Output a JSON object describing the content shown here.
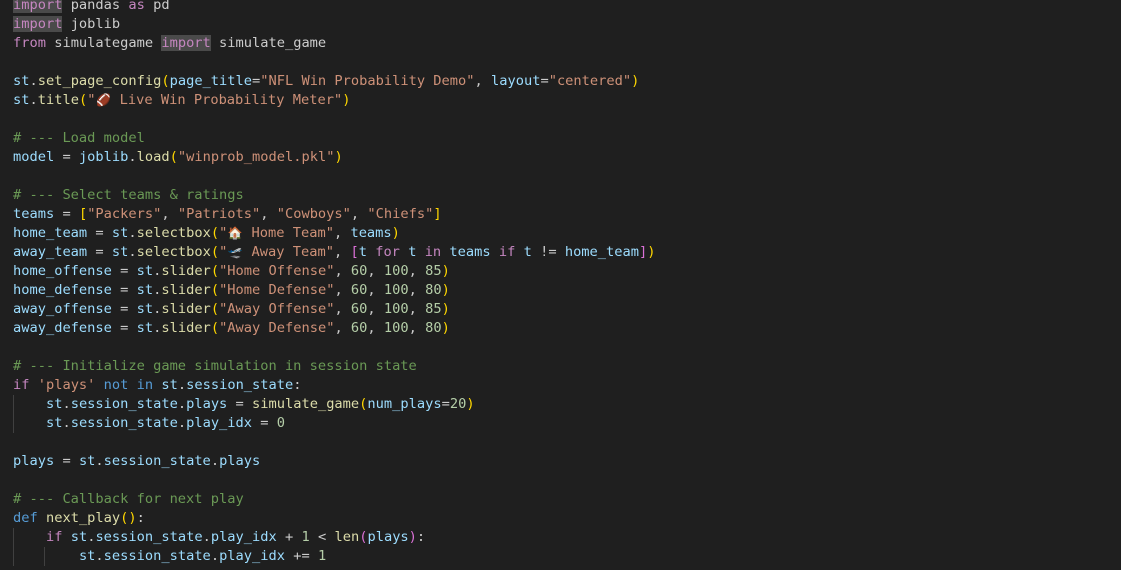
{
  "editor": {
    "language": "python",
    "theme_colors": {
      "background": "#1f1f1f",
      "plain": "#cccccc",
      "keyword": "#c586c0",
      "keyword_blue": "#569cd6",
      "string": "#ce9178",
      "number": "#b5cea8",
      "variable": "#9cdcfe",
      "function": "#dcdcaa",
      "comment": "#6a9955",
      "bracket_1": "#ffd700",
      "bracket_2": "#da70d6",
      "bracket_3": "#179fff"
    },
    "lines": [
      {
        "indent": 0,
        "tokens": [
          {
            "t": "import",
            "c": "keyword",
            "hl": true
          },
          {
            "t": " pandas ",
            "c": "plain"
          },
          {
            "t": "as",
            "c": "keyword"
          },
          {
            "t": " pd",
            "c": "plain"
          }
        ]
      },
      {
        "indent": 0,
        "tokens": [
          {
            "t": "import",
            "c": "keyword",
            "hl": true
          },
          {
            "t": " joblib",
            "c": "plain"
          }
        ]
      },
      {
        "indent": 0,
        "tokens": [
          {
            "t": "from",
            "c": "keyword"
          },
          {
            "t": " simulategame ",
            "c": "plain"
          },
          {
            "t": "import",
            "c": "keyword",
            "hl": true
          },
          {
            "t": " simulate_game",
            "c": "plain"
          }
        ]
      },
      {
        "indent": 0,
        "tokens": []
      },
      {
        "indent": 0,
        "tokens": [
          {
            "t": "st",
            "c": "variable"
          },
          {
            "t": ".",
            "c": "plain"
          },
          {
            "t": "set_page_config",
            "c": "function"
          },
          {
            "t": "(",
            "c": "bracket_1"
          },
          {
            "t": "page_title",
            "c": "variable"
          },
          {
            "t": "=",
            "c": "plain"
          },
          {
            "t": "\"NFL Win Probability Demo\"",
            "c": "string"
          },
          {
            "t": ", ",
            "c": "plain"
          },
          {
            "t": "layout",
            "c": "variable"
          },
          {
            "t": "=",
            "c": "plain"
          },
          {
            "t": "\"centered\"",
            "c": "string"
          },
          {
            "t": ")",
            "c": "bracket_1"
          }
        ]
      },
      {
        "indent": 0,
        "tokens": [
          {
            "t": "st",
            "c": "variable"
          },
          {
            "t": ".",
            "c": "plain"
          },
          {
            "t": "title",
            "c": "function"
          },
          {
            "t": "(",
            "c": "bracket_1"
          },
          {
            "t": "\"",
            "c": "string"
          },
          {
            "t": "🏈",
            "c": "emoji"
          },
          {
            "t": " Live Win Probability Meter\"",
            "c": "string"
          },
          {
            "t": ")",
            "c": "bracket_1"
          }
        ]
      },
      {
        "indent": 0,
        "tokens": []
      },
      {
        "indent": 0,
        "tokens": [
          {
            "t": "# --- Load model",
            "c": "comment"
          }
        ]
      },
      {
        "indent": 0,
        "tokens": [
          {
            "t": "model",
            "c": "variable"
          },
          {
            "t": " = ",
            "c": "plain"
          },
          {
            "t": "joblib",
            "c": "variable"
          },
          {
            "t": ".",
            "c": "plain"
          },
          {
            "t": "load",
            "c": "function"
          },
          {
            "t": "(",
            "c": "bracket_1"
          },
          {
            "t": "\"winprob_model.pkl\"",
            "c": "string"
          },
          {
            "t": ")",
            "c": "bracket_1"
          }
        ]
      },
      {
        "indent": 0,
        "tokens": []
      },
      {
        "indent": 0,
        "tokens": [
          {
            "t": "# --- Select teams & ratings",
            "c": "comment"
          }
        ]
      },
      {
        "indent": 0,
        "tokens": [
          {
            "t": "teams",
            "c": "variable"
          },
          {
            "t": " = ",
            "c": "plain"
          },
          {
            "t": "[",
            "c": "bracket_1"
          },
          {
            "t": "\"Packers\"",
            "c": "string"
          },
          {
            "t": ", ",
            "c": "plain"
          },
          {
            "t": "\"Patriots\"",
            "c": "string"
          },
          {
            "t": ", ",
            "c": "plain"
          },
          {
            "t": "\"Cowboys\"",
            "c": "string"
          },
          {
            "t": ", ",
            "c": "plain"
          },
          {
            "t": "\"Chiefs\"",
            "c": "string"
          },
          {
            "t": "]",
            "c": "bracket_1"
          }
        ]
      },
      {
        "indent": 0,
        "tokens": [
          {
            "t": "home_team",
            "c": "variable"
          },
          {
            "t": " = ",
            "c": "plain"
          },
          {
            "t": "st",
            "c": "variable"
          },
          {
            "t": ".",
            "c": "plain"
          },
          {
            "t": "selectbox",
            "c": "function"
          },
          {
            "t": "(",
            "c": "bracket_1"
          },
          {
            "t": "\"",
            "c": "string"
          },
          {
            "t": "🏠",
            "c": "emoji"
          },
          {
            "t": " Home Team\"",
            "c": "string"
          },
          {
            "t": ", ",
            "c": "plain"
          },
          {
            "t": "teams",
            "c": "variable"
          },
          {
            "t": ")",
            "c": "bracket_1"
          }
        ]
      },
      {
        "indent": 0,
        "tokens": [
          {
            "t": "away_team",
            "c": "variable"
          },
          {
            "t": " = ",
            "c": "plain"
          },
          {
            "t": "st",
            "c": "variable"
          },
          {
            "t": ".",
            "c": "plain"
          },
          {
            "t": "selectbox",
            "c": "function"
          },
          {
            "t": "(",
            "c": "bracket_1"
          },
          {
            "t": "\"",
            "c": "string"
          },
          {
            "t": "🛫",
            "c": "emoji"
          },
          {
            "t": " Away Team\"",
            "c": "string"
          },
          {
            "t": ", ",
            "c": "plain"
          },
          {
            "t": "[",
            "c": "bracket_2"
          },
          {
            "t": "t",
            "c": "variable"
          },
          {
            "t": " ",
            "c": "plain"
          },
          {
            "t": "for",
            "c": "keyword"
          },
          {
            "t": " ",
            "c": "plain"
          },
          {
            "t": "t",
            "c": "variable"
          },
          {
            "t": " ",
            "c": "plain"
          },
          {
            "t": "in",
            "c": "keyword"
          },
          {
            "t": " ",
            "c": "plain"
          },
          {
            "t": "teams",
            "c": "variable"
          },
          {
            "t": " ",
            "c": "plain"
          },
          {
            "t": "if",
            "c": "keyword"
          },
          {
            "t": " ",
            "c": "plain"
          },
          {
            "t": "t",
            "c": "variable"
          },
          {
            "t": " != ",
            "c": "plain"
          },
          {
            "t": "home_team",
            "c": "variable"
          },
          {
            "t": "]",
            "c": "bracket_2"
          },
          {
            "t": ")",
            "c": "bracket_1"
          }
        ]
      },
      {
        "indent": 0,
        "tokens": [
          {
            "t": "home_offense",
            "c": "variable"
          },
          {
            "t": " = ",
            "c": "plain"
          },
          {
            "t": "st",
            "c": "variable"
          },
          {
            "t": ".",
            "c": "plain"
          },
          {
            "t": "slider",
            "c": "function"
          },
          {
            "t": "(",
            "c": "bracket_1"
          },
          {
            "t": "\"Home Offense\"",
            "c": "string"
          },
          {
            "t": ", ",
            "c": "plain"
          },
          {
            "t": "60",
            "c": "number"
          },
          {
            "t": ", ",
            "c": "plain"
          },
          {
            "t": "100",
            "c": "number"
          },
          {
            "t": ", ",
            "c": "plain"
          },
          {
            "t": "85",
            "c": "number"
          },
          {
            "t": ")",
            "c": "bracket_1"
          }
        ]
      },
      {
        "indent": 0,
        "tokens": [
          {
            "t": "home_defense",
            "c": "variable"
          },
          {
            "t": " = ",
            "c": "plain"
          },
          {
            "t": "st",
            "c": "variable"
          },
          {
            "t": ".",
            "c": "plain"
          },
          {
            "t": "slider",
            "c": "function"
          },
          {
            "t": "(",
            "c": "bracket_1"
          },
          {
            "t": "\"Home Defense\"",
            "c": "string"
          },
          {
            "t": ", ",
            "c": "plain"
          },
          {
            "t": "60",
            "c": "number"
          },
          {
            "t": ", ",
            "c": "plain"
          },
          {
            "t": "100",
            "c": "number"
          },
          {
            "t": ", ",
            "c": "plain"
          },
          {
            "t": "80",
            "c": "number"
          },
          {
            "t": ")",
            "c": "bracket_1"
          }
        ]
      },
      {
        "indent": 0,
        "tokens": [
          {
            "t": "away_offense",
            "c": "variable"
          },
          {
            "t": " = ",
            "c": "plain"
          },
          {
            "t": "st",
            "c": "variable"
          },
          {
            "t": ".",
            "c": "plain"
          },
          {
            "t": "slider",
            "c": "function"
          },
          {
            "t": "(",
            "c": "bracket_1"
          },
          {
            "t": "\"Away Offense\"",
            "c": "string"
          },
          {
            "t": ", ",
            "c": "plain"
          },
          {
            "t": "60",
            "c": "number"
          },
          {
            "t": ", ",
            "c": "plain"
          },
          {
            "t": "100",
            "c": "number"
          },
          {
            "t": ", ",
            "c": "plain"
          },
          {
            "t": "85",
            "c": "number"
          },
          {
            "t": ")",
            "c": "bracket_1"
          }
        ]
      },
      {
        "indent": 0,
        "tokens": [
          {
            "t": "away_defense",
            "c": "variable"
          },
          {
            "t": " = ",
            "c": "plain"
          },
          {
            "t": "st",
            "c": "variable"
          },
          {
            "t": ".",
            "c": "plain"
          },
          {
            "t": "slider",
            "c": "function"
          },
          {
            "t": "(",
            "c": "bracket_1"
          },
          {
            "t": "\"Away Defense\"",
            "c": "string"
          },
          {
            "t": ", ",
            "c": "plain"
          },
          {
            "t": "60",
            "c": "number"
          },
          {
            "t": ", ",
            "c": "plain"
          },
          {
            "t": "100",
            "c": "number"
          },
          {
            "t": ", ",
            "c": "plain"
          },
          {
            "t": "80",
            "c": "number"
          },
          {
            "t": ")",
            "c": "bracket_1"
          }
        ]
      },
      {
        "indent": 0,
        "tokens": []
      },
      {
        "indent": 0,
        "tokens": [
          {
            "t": "# --- Initialize game simulation in session state",
            "c": "comment"
          }
        ]
      },
      {
        "indent": 0,
        "tokens": [
          {
            "t": "if",
            "c": "keyword"
          },
          {
            "t": " ",
            "c": "plain"
          },
          {
            "t": "'plays'",
            "c": "string"
          },
          {
            "t": " ",
            "c": "plain"
          },
          {
            "t": "not",
            "c": "keyword_blue"
          },
          {
            "t": " ",
            "c": "plain"
          },
          {
            "t": "in",
            "c": "keyword_blue"
          },
          {
            "t": " ",
            "c": "plain"
          },
          {
            "t": "st",
            "c": "variable"
          },
          {
            "t": ".",
            "c": "plain"
          },
          {
            "t": "session_state",
            "c": "variable"
          },
          {
            "t": ":",
            "c": "plain"
          }
        ]
      },
      {
        "indent": 1,
        "tokens": [
          {
            "t": "st",
            "c": "variable"
          },
          {
            "t": ".",
            "c": "plain"
          },
          {
            "t": "session_state",
            "c": "variable"
          },
          {
            "t": ".",
            "c": "plain"
          },
          {
            "t": "plays",
            "c": "variable"
          },
          {
            "t": " = ",
            "c": "plain"
          },
          {
            "t": "simulate_game",
            "c": "function"
          },
          {
            "t": "(",
            "c": "bracket_1"
          },
          {
            "t": "num_plays",
            "c": "variable"
          },
          {
            "t": "=",
            "c": "plain"
          },
          {
            "t": "20",
            "c": "number"
          },
          {
            "t": ")",
            "c": "bracket_1"
          }
        ]
      },
      {
        "indent": 1,
        "tokens": [
          {
            "t": "st",
            "c": "variable"
          },
          {
            "t": ".",
            "c": "plain"
          },
          {
            "t": "session_state",
            "c": "variable"
          },
          {
            "t": ".",
            "c": "plain"
          },
          {
            "t": "play_idx",
            "c": "variable"
          },
          {
            "t": " = ",
            "c": "plain"
          },
          {
            "t": "0",
            "c": "number"
          }
        ]
      },
      {
        "indent": 0,
        "tokens": []
      },
      {
        "indent": 0,
        "tokens": [
          {
            "t": "plays",
            "c": "variable"
          },
          {
            "t": " = ",
            "c": "plain"
          },
          {
            "t": "st",
            "c": "variable"
          },
          {
            "t": ".",
            "c": "plain"
          },
          {
            "t": "session_state",
            "c": "variable"
          },
          {
            "t": ".",
            "c": "plain"
          },
          {
            "t": "plays",
            "c": "variable"
          }
        ]
      },
      {
        "indent": 0,
        "tokens": []
      },
      {
        "indent": 0,
        "tokens": [
          {
            "t": "# --- Callback for next play",
            "c": "comment"
          }
        ]
      },
      {
        "indent": 0,
        "tokens": [
          {
            "t": "def",
            "c": "keyword_blue"
          },
          {
            "t": " ",
            "c": "plain"
          },
          {
            "t": "next_play",
            "c": "function"
          },
          {
            "t": "()",
            "c": "bracket_1"
          },
          {
            "t": ":",
            "c": "plain"
          }
        ]
      },
      {
        "indent": 1,
        "tokens": [
          {
            "t": "if",
            "c": "keyword"
          },
          {
            "t": " ",
            "c": "plain"
          },
          {
            "t": "st",
            "c": "variable"
          },
          {
            "t": ".",
            "c": "plain"
          },
          {
            "t": "session_state",
            "c": "variable"
          },
          {
            "t": ".",
            "c": "plain"
          },
          {
            "t": "play_idx",
            "c": "variable"
          },
          {
            "t": " + ",
            "c": "plain"
          },
          {
            "t": "1",
            "c": "number"
          },
          {
            "t": " < ",
            "c": "plain"
          },
          {
            "t": "len",
            "c": "function"
          },
          {
            "t": "(",
            "c": "bracket_2"
          },
          {
            "t": "plays",
            "c": "variable"
          },
          {
            "t": ")",
            "c": "bracket_2"
          },
          {
            "t": ":",
            "c": "plain"
          }
        ]
      },
      {
        "indent": 2,
        "tokens": [
          {
            "t": "st",
            "c": "variable"
          },
          {
            "t": ".",
            "c": "plain"
          },
          {
            "t": "session_state",
            "c": "variable"
          },
          {
            "t": ".",
            "c": "plain"
          },
          {
            "t": "play_idx",
            "c": "variable"
          },
          {
            "t": " += ",
            "c": "plain"
          },
          {
            "t": "1",
            "c": "number"
          }
        ]
      }
    ]
  }
}
